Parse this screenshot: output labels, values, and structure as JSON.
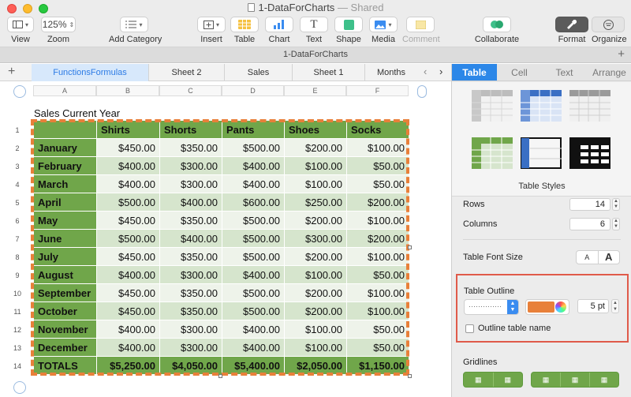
{
  "window": {
    "title": "1-DataForCharts",
    "subtitle": "— Shared"
  },
  "toolbar": {
    "view_label": "View",
    "zoom_value": "125%",
    "zoom_label": "Zoom",
    "add_category_label": "Add Category",
    "insert_label": "Insert",
    "table_label": "Table",
    "chart_label": "Chart",
    "text_label": "Text",
    "shape_label": "Shape",
    "media_label": "Media",
    "comment_label": "Comment",
    "collaborate_label": "Collaborate",
    "format_label": "Format",
    "organize_label": "Organize",
    "text_glyph": "T"
  },
  "document_name": "1-DataForCharts",
  "sheet_tabs": [
    "FunctionsFormulas",
    "Sheet 2",
    "Sales",
    "Sheet 1",
    "Months"
  ],
  "column_headers": [
    "A",
    "B",
    "C",
    "D",
    "E",
    "F"
  ],
  "row_numbers": [
    "1",
    "2",
    "3",
    "4",
    "5",
    "6",
    "7",
    "8",
    "9",
    "10",
    "11",
    "12",
    "13",
    "14"
  ],
  "table": {
    "title": "Sales Current Year",
    "headers": [
      "",
      "Shirts",
      "Shorts",
      "Pants",
      "Shoes",
      "Socks"
    ],
    "rows": [
      {
        "month": "January",
        "values": [
          "$450.00",
          "$350.00",
          "$500.00",
          "$200.00",
          "$100.00"
        ]
      },
      {
        "month": "February",
        "values": [
          "$400.00",
          "$300.00",
          "$400.00",
          "$100.00",
          "$50.00"
        ]
      },
      {
        "month": "March",
        "values": [
          "$400.00",
          "$300.00",
          "$400.00",
          "$100.00",
          "$50.00"
        ]
      },
      {
        "month": "April",
        "values": [
          "$500.00",
          "$400.00",
          "$600.00",
          "$250.00",
          "$200.00"
        ]
      },
      {
        "month": "May",
        "values": [
          "$450.00",
          "$350.00",
          "$500.00",
          "$200.00",
          "$100.00"
        ]
      },
      {
        "month": "June",
        "values": [
          "$500.00",
          "$400.00",
          "$500.00",
          "$300.00",
          "$200.00"
        ]
      },
      {
        "month": "July",
        "values": [
          "$450.00",
          "$350.00",
          "$500.00",
          "$200.00",
          "$100.00"
        ]
      },
      {
        "month": "August",
        "values": [
          "$400.00",
          "$300.00",
          "$400.00",
          "$100.00",
          "$50.00"
        ]
      },
      {
        "month": "September",
        "values": [
          "$450.00",
          "$350.00",
          "$500.00",
          "$200.00",
          "$100.00"
        ]
      },
      {
        "month": "October",
        "values": [
          "$450.00",
          "$350.00",
          "$500.00",
          "$200.00",
          "$100.00"
        ]
      },
      {
        "month": "November",
        "values": [
          "$400.00",
          "$300.00",
          "$400.00",
          "$100.00",
          "$50.00"
        ]
      },
      {
        "month": "December",
        "values": [
          "$400.00",
          "$300.00",
          "$400.00",
          "$100.00",
          "$50.00"
        ]
      }
    ],
    "totals": {
      "label": "TOTALS",
      "values": [
        "$5,250.00",
        "$4,050.00",
        "$5,400.00",
        "$2,050.00",
        "$1,150.00"
      ]
    }
  },
  "inspector": {
    "tabs": [
      "Table",
      "Cell",
      "Text",
      "Arrange"
    ],
    "active_tab": "Table",
    "table_styles_label": "Table Styles",
    "rows_label": "Rows",
    "rows_value": "14",
    "columns_label": "Columns",
    "columns_value": "6",
    "font_size_label": "Table Font Size",
    "font_smaller": "A",
    "font_larger": "A",
    "outline_label": "Table Outline",
    "outline_style": "··············",
    "outline_color": "#e8803a",
    "outline_width": "5 pt",
    "outline_table_name_label": "Outline table name",
    "outline_table_name_checked": false,
    "gridlines_label": "Gridlines"
  },
  "colors": {
    "header_green": "#70a64a",
    "accent_blue": "#2c87e8",
    "outline_orange": "#e8803a",
    "highlight_red": "#e05a4a"
  }
}
